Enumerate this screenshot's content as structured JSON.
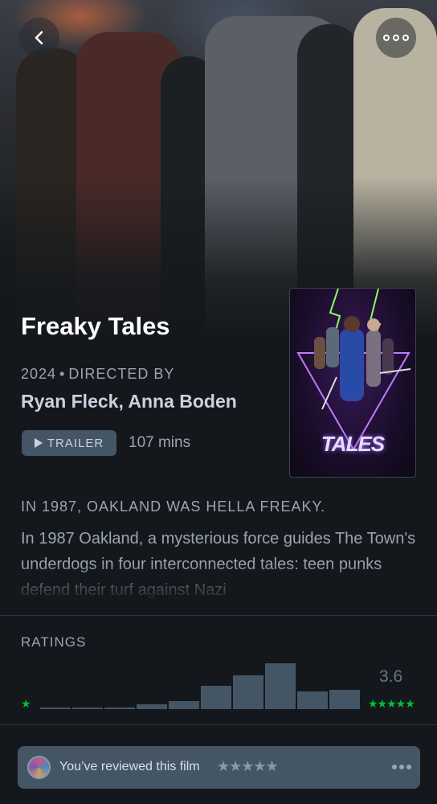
{
  "film": {
    "title": "Freaky Tales",
    "year": "2024",
    "directed_by_label": "DIRECTED BY",
    "directors": "Ryan Fleck, Anna Boden",
    "trailer_label": "TRAILER",
    "runtime": "107 mins",
    "poster_title": "TALES",
    "tagline": "IN 1987, OAKLAND WAS HELLA FREAKY.",
    "synopsis": "In 1987 Oakland, a mysterious force guides The Town's underdogs in four interconnected tales: teen punks defend their turf against Nazi"
  },
  "nav": {
    "back_icon": "chevron-left-icon",
    "more_icon": "more-horizontal-icon"
  },
  "ratings": {
    "label": "RATINGS",
    "average": "3.6",
    "min_star": "★",
    "max_stars": "★★★★★",
    "histogram_values": [
      0.03,
      0.03,
      0.04,
      0.09,
      0.16,
      0.46,
      0.67,
      0.92,
      0.35,
      0.38
    ]
  },
  "review": {
    "text": "You’ve reviewed this film",
    "stars": "★★★★★"
  },
  "colors": {
    "background": "#14181c",
    "accent_green": "#00c030",
    "bar": "#445566"
  }
}
